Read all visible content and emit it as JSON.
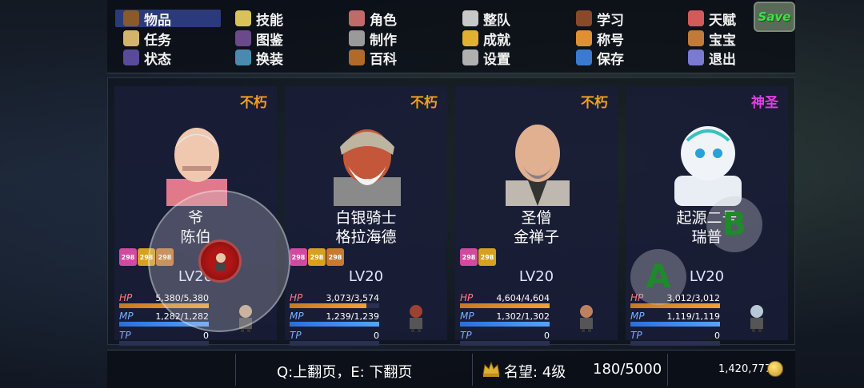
{
  "menu": {
    "items": [
      {
        "label": "物品",
        "icon": "bag-icon",
        "color": "#8a5a2a",
        "active": true
      },
      {
        "label": "技能",
        "icon": "lightning-icon",
        "color": "#d9c25a"
      },
      {
        "label": "角色",
        "icon": "mask-icon",
        "color": "#c06a6a"
      },
      {
        "label": "整队",
        "icon": "flag-icon",
        "color": "#c8c8c8"
      },
      {
        "label": "学习",
        "icon": "book-icon",
        "color": "#8a4a2a"
      },
      {
        "label": "天赋",
        "icon": "talent-icon",
        "color": "#d45a5a"
      },
      {
        "label": "任务",
        "icon": "scroll-icon",
        "color": "#d4b46a"
      },
      {
        "label": "图鉴",
        "icon": "album-icon",
        "color": "#6a4a8a"
      },
      {
        "label": "制作",
        "icon": "anvil-icon",
        "color": "#9a9a9a"
      },
      {
        "label": "成就",
        "icon": "trophy-icon",
        "color": "#e0b030"
      },
      {
        "label": "称号",
        "icon": "medal-icon",
        "color": "#e09030"
      },
      {
        "label": "宝宝",
        "icon": "pet-icon",
        "color": "#c07a3a"
      },
      {
        "label": "状态",
        "icon": "status-icon",
        "color": "#5a4a9a"
      },
      {
        "label": "换装",
        "icon": "outfit-icon",
        "color": "#4a8ab0"
      },
      {
        "label": "百科",
        "icon": "encyclopedia-icon",
        "color": "#b06a2a"
      },
      {
        "label": "设置",
        "icon": "gear-icon",
        "color": "#b0b0b0"
      },
      {
        "label": "保存",
        "icon": "floppy-icon",
        "color": "#3a7ad0"
      },
      {
        "label": "退出",
        "icon": "exit-icon",
        "color": "#7a7ad0"
      }
    ],
    "save_label": "Save"
  },
  "party": [
    {
      "tier": "不朽",
      "tier_color": "#f0a020",
      "name1": "爷",
      "name2": "陈伯",
      "portrait": "elder-portrait",
      "badges": [
        "298",
        "298",
        "298"
      ],
      "level": "LV20",
      "hp": "5,380/5,380",
      "hp_pct": 1.0,
      "mp": "1,282/1,282",
      "mp_pct": 1.0,
      "tp": "0",
      "tp_pct": 0
    },
    {
      "tier": "不朽",
      "tier_color": "#f0a020",
      "name1": "白银骑士",
      "name2": "格拉海德",
      "portrait": "knight-portrait",
      "badges": [
        "298",
        "298",
        "298"
      ],
      "level": "LV20",
      "hp": "3,073/3,574",
      "hp_pct": 0.86,
      "mp": "1,239/1,239",
      "mp_pct": 1.0,
      "tp": "0",
      "tp_pct": 0
    },
    {
      "tier": "不朽",
      "tier_color": "#f0a020",
      "name1": "圣僧",
      "name2": "金禅子",
      "portrait": "monk-portrait",
      "badges": [
        "298",
        "298"
      ],
      "level": "LV20",
      "hp": "4,604/4,604",
      "hp_pct": 1.0,
      "mp": "1,302/1,302",
      "mp_pct": 1.0,
      "tp": "0",
      "tp_pct": 0
    },
    {
      "tier": "神圣",
      "tier_color": "#e040e0",
      "name1": "起源二号",
      "name2": "瑞普",
      "portrait": "robot-portrait",
      "badges": [],
      "level": "LV20",
      "hp": "3,012/3,012",
      "hp_pct": 1.0,
      "mp": "1,119/1,119",
      "mp_pct": 1.0,
      "tp": "0",
      "tp_pct": 0
    }
  ],
  "stat_labels": {
    "hp": "HP",
    "mp": "MP",
    "tp": "TP"
  },
  "bottom": {
    "page_hint": "Q:上翻页，E: 下翻页",
    "fame_label": "名望: 4级",
    "fame_value": "180/5000",
    "gold": "1,420,777"
  },
  "controls": {
    "a_label": "A",
    "b_label": "B"
  }
}
